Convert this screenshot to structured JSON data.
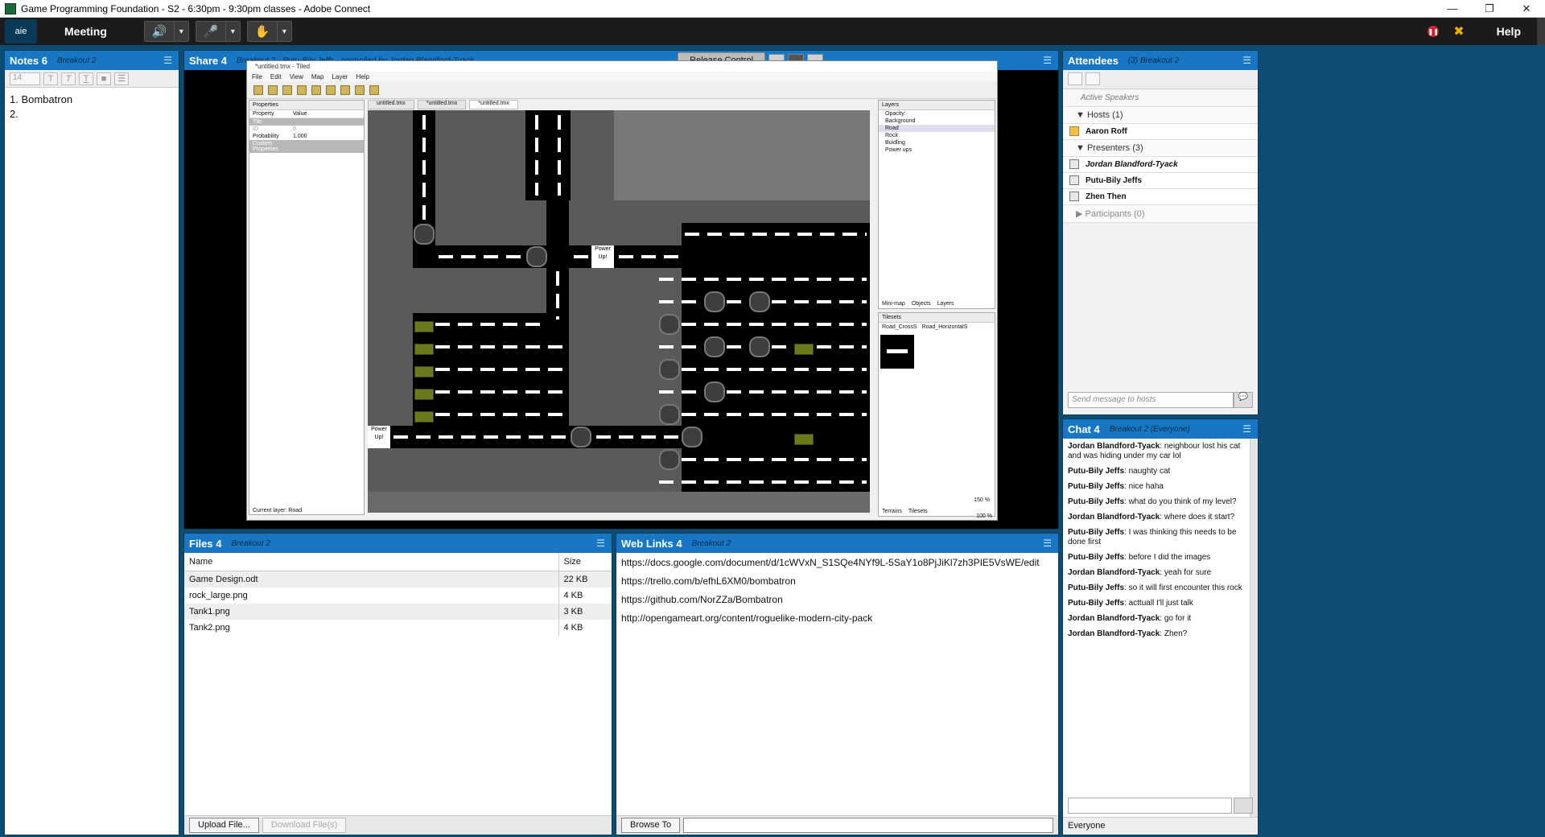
{
  "window": {
    "title": "Game Programming Foundation - S2 - 6:30pm - 9:30pm classes - Adobe Connect"
  },
  "menubar": {
    "logo": "aie",
    "meeting": "Meeting",
    "help": "Help"
  },
  "notes": {
    "title": "Notes 6",
    "subtitle": "Breakout 2",
    "font_size": "14",
    "lines": [
      "1. Bombatron",
      "2."
    ]
  },
  "share": {
    "title": "Share 4",
    "subtitle": "Breakout 2 - Putu-Bily Jeffs - controlled by Jordan Blandford-Tyack",
    "release_label": "Release Control",
    "tiled": {
      "title": "*untitled.tmx - Tiled",
      "menu": [
        "File",
        "Edit",
        "View",
        "Map",
        "Layer",
        "Help"
      ],
      "properties_title": "Properties",
      "prop_headers": [
        "Property",
        "Value"
      ],
      "props": [
        {
          "k": "Tile",
          "v": ""
        },
        {
          "k": "ID",
          "v": "0"
        },
        {
          "k": "Probability",
          "v": "1.000"
        },
        {
          "k": "Custom Properties",
          "v": ""
        }
      ],
      "tabs": [
        "untitled.tmx",
        "*untitled.tmx",
        "*untitled.tmx"
      ],
      "layers_title": "Layers",
      "opacity_label": "Opacity:",
      "layers": [
        "Background",
        "Road",
        "Rock",
        "Buidling",
        "Power ups"
      ],
      "layer_tabs": [
        "Mini-map",
        "Objects",
        "Layers"
      ],
      "tilesets_title": "Tilesets",
      "tileset_tabs": [
        "Road_CrossS",
        "Road_HorizontalS"
      ],
      "zoom": "150 %",
      "zoom2": "100 %",
      "bottom_tabs": [
        "Terrains",
        "Tilesets"
      ],
      "status": "Current layer: Road",
      "powerup_text": "Power Up!"
    }
  },
  "attendees": {
    "title": "Attendees",
    "subtitle": "(3) Breakout 2",
    "active_speakers": "Active Speakers",
    "hosts_label": "Hosts (1)",
    "hosts": [
      "Aaron Roff"
    ],
    "presenters_label": "Presenters (3)",
    "presenters": [
      "Jordan Blandford-Tyack",
      "Putu-Bily Jeffs",
      "Zhen Then"
    ],
    "participants_label": "Participants (0)",
    "send_placeholder": "Send message to hosts"
  },
  "files": {
    "title": "Files 4",
    "subtitle": "Breakout 2",
    "headers": [
      "Name",
      "Size"
    ],
    "rows": [
      {
        "name": "Game Design.odt",
        "size": "22 KB"
      },
      {
        "name": "rock_large.png",
        "size": "4 KB"
      },
      {
        "name": "Tank1.png",
        "size": "3 KB"
      },
      {
        "name": "Tank2.png",
        "size": "4 KB"
      }
    ],
    "upload_label": "Upload File...",
    "download_label": "Download File(s)"
  },
  "links": {
    "title": "Web Links 4",
    "subtitle": "Breakout 2",
    "items": [
      "https://docs.google.com/document/d/1cWVxN_S1SQe4NYf9L-5SaY1o8PjJiKl7zh3PIE5VsWE/edit",
      "https://trello.com/b/efhL6XM0/bombatron",
      "https://github.com/NorZZa/Bombatron",
      "http://opengameart.org/content/roguelike-modern-city-pack"
    ],
    "browse_label": "Browse To"
  },
  "chat": {
    "title": "Chat 4",
    "subtitle": "Breakout 2 (Everyone)",
    "messages": [
      {
        "from": "Jordan Blandford-Tyack",
        "text": "neighbour lost his cat and was hiding under my car lol"
      },
      {
        "from": "Putu-Bily Jeffs",
        "text": "naughty cat"
      },
      {
        "from": "Putu-Bily Jeffs",
        "text": "nice haha"
      },
      {
        "from": "Putu-Bily Jeffs",
        "text": "what do you think of my level?"
      },
      {
        "from": "Jordan Blandford-Tyack",
        "text": "where does it start?"
      },
      {
        "from": "Putu-Bily Jeffs",
        "text": "I was thinking this needs to be done first"
      },
      {
        "from": "Putu-Bily Jeffs",
        "text": "before I did the images"
      },
      {
        "from": "Jordan Blandford-Tyack",
        "text": "yeah for sure"
      },
      {
        "from": "Putu-Bily Jeffs",
        "text": "so it will first encounter this rock"
      },
      {
        "from": "Putu-Bily Jeffs",
        "text": "acttuall I'll just talk"
      },
      {
        "from": "Jordan Blandford-Tyack",
        "text": "go for it"
      },
      {
        "from": "Jordan Blandford-Tyack",
        "text": "Zhen?"
      }
    ],
    "recipient": "Everyone"
  },
  "colors": {
    "pod_header": "#1777c4",
    "app_bg": "#0e4d73",
    "menubar": "#1b1b1b"
  }
}
